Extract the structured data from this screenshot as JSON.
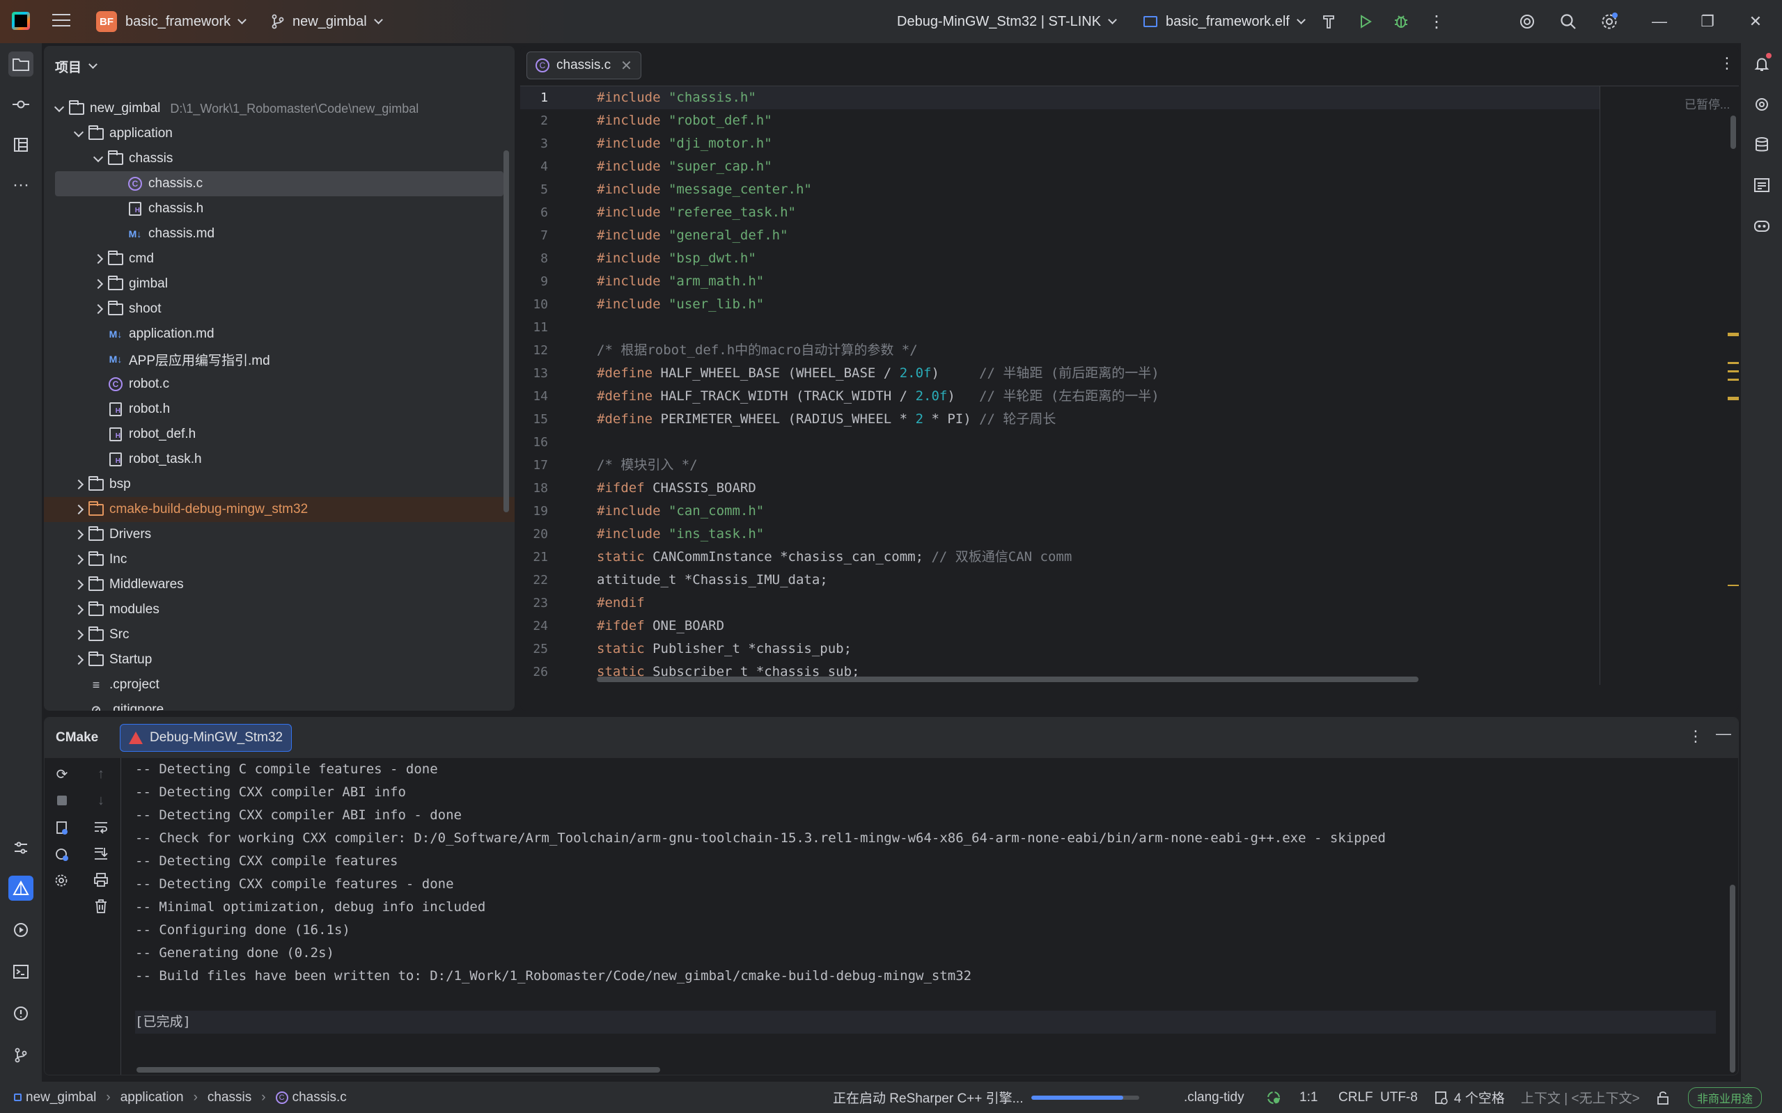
{
  "titlebar": {
    "project_badge": "BF",
    "project_name": "basic_framework",
    "branch": "new_gimbal",
    "run_config": "Debug-MinGW_Stm32 | ST-LINK",
    "target": "basic_framework.elf"
  },
  "project_panel": {
    "title": "项目",
    "tree": [
      {
        "label": "new_gimbal",
        "path": "D:\\1_Work\\1_Robomaster\\Code\\new_gimbal",
        "depth": 0,
        "type": "folder",
        "open": true
      },
      {
        "label": "application",
        "depth": 1,
        "type": "folder",
        "open": true
      },
      {
        "label": "chassis",
        "depth": 2,
        "type": "folder",
        "open": true
      },
      {
        "label": "chassis.c",
        "depth": 3,
        "type": "c",
        "selected": true
      },
      {
        "label": "chassis.h",
        "depth": 3,
        "type": "h"
      },
      {
        "label": "chassis.md",
        "depth": 3,
        "type": "md"
      },
      {
        "label": "cmd",
        "depth": 2,
        "type": "folder",
        "open": false
      },
      {
        "label": "gimbal",
        "depth": 2,
        "type": "folder",
        "open": false
      },
      {
        "label": "shoot",
        "depth": 2,
        "type": "folder",
        "open": false
      },
      {
        "label": "application.md",
        "depth": 2,
        "type": "md"
      },
      {
        "label": "APP层应用编写指引.md",
        "depth": 2,
        "type": "md"
      },
      {
        "label": "robot.c",
        "depth": 2,
        "type": "c"
      },
      {
        "label": "robot.h",
        "depth": 2,
        "type": "h"
      },
      {
        "label": "robot_def.h",
        "depth": 2,
        "type": "h"
      },
      {
        "label": "robot_task.h",
        "depth": 2,
        "type": "h"
      },
      {
        "label": "bsp",
        "depth": 1,
        "type": "folder",
        "open": false
      },
      {
        "label": "cmake-build-debug-mingw_stm32",
        "depth": 1,
        "type": "folder-excluded",
        "open": false
      },
      {
        "label": "Drivers",
        "depth": 1,
        "type": "folder",
        "open": false
      },
      {
        "label": "Inc",
        "depth": 1,
        "type": "folder",
        "open": false
      },
      {
        "label": "Middlewares",
        "depth": 1,
        "type": "folder",
        "open": false
      },
      {
        "label": "modules",
        "depth": 1,
        "type": "folder",
        "open": false
      },
      {
        "label": "Src",
        "depth": 1,
        "type": "folder",
        "open": false
      },
      {
        "label": "Startup",
        "depth": 1,
        "type": "folder",
        "open": false
      },
      {
        "label": ".cproject",
        "depth": 1,
        "type": "txt"
      },
      {
        "label": ".gitignore",
        "depth": 1,
        "type": "ignore"
      }
    ]
  },
  "editor": {
    "tab_label": "chassis.c",
    "inspection_status": "已暂停...",
    "current_line": 1,
    "lines": [
      [
        [
          "kw",
          "#include"
        ],
        [
          "",
          " "
        ],
        [
          "str",
          "\"chassis.h\""
        ]
      ],
      [
        [
          "kw",
          "#include"
        ],
        [
          "",
          " "
        ],
        [
          "str",
          "\"robot_def.h\""
        ]
      ],
      [
        [
          "kw",
          "#include"
        ],
        [
          "",
          " "
        ],
        [
          "str",
          "\"dji_motor.h\""
        ]
      ],
      [
        [
          "kw",
          "#include"
        ],
        [
          "",
          " "
        ],
        [
          "str",
          "\"super_cap.h\""
        ]
      ],
      [
        [
          "kw",
          "#include"
        ],
        [
          "",
          " "
        ],
        [
          "str",
          "\"message_center.h\""
        ]
      ],
      [
        [
          "kw",
          "#include"
        ],
        [
          "",
          " "
        ],
        [
          "str",
          "\"referee_task.h\""
        ]
      ],
      [
        [
          "kw",
          "#include"
        ],
        [
          "",
          " "
        ],
        [
          "str",
          "\"general_def.h\""
        ]
      ],
      [
        [
          "kw",
          "#include"
        ],
        [
          "",
          " "
        ],
        [
          "str",
          "\"bsp_dwt.h\""
        ]
      ],
      [
        [
          "kw",
          "#include"
        ],
        [
          "",
          " "
        ],
        [
          "str",
          "\"arm_math.h\""
        ]
      ],
      [
        [
          "kw",
          "#include"
        ],
        [
          "",
          " "
        ],
        [
          "str",
          "\"user_lib.h\""
        ]
      ],
      [],
      [
        [
          "cmt",
          "/* 根据robot_def.h中的macro自动计算的参数 */"
        ]
      ],
      [
        [
          "kw",
          "#define"
        ],
        [
          "",
          " HALF_WHEEL_BASE (WHEEL_BASE / "
        ],
        [
          "num",
          "2.0f"
        ],
        [
          "",
          ")     "
        ],
        [
          "cmt",
          "// 半轴距 (前后距离的一半)"
        ]
      ],
      [
        [
          "kw",
          "#define"
        ],
        [
          "",
          " HALF_TRACK_WIDTH (TRACK_WIDTH / "
        ],
        [
          "num",
          "2.0f"
        ],
        [
          "",
          ")   "
        ],
        [
          "cmt",
          "// 半轮距 (左右距离的一半)"
        ]
      ],
      [
        [
          "kw",
          "#define"
        ],
        [
          "",
          " PERIMETER_WHEEL (RADIUS_WHEEL * "
        ],
        [
          "num",
          "2"
        ],
        [
          "",
          " * PI) "
        ],
        [
          "cmt",
          "// 轮子周长"
        ]
      ],
      [],
      [
        [
          "cmt",
          "/* 模块引入 */"
        ]
      ],
      [
        [
          "kw",
          "#ifdef"
        ],
        [
          "",
          " CHASSIS_BOARD"
        ]
      ],
      [
        [
          "kw",
          "#include"
        ],
        [
          "",
          " "
        ],
        [
          "str",
          "\"can_comm.h\""
        ]
      ],
      [
        [
          "kw",
          "#include"
        ],
        [
          "",
          " "
        ],
        [
          "str",
          "\"ins_task.h\""
        ]
      ],
      [
        [
          "kw",
          "static"
        ],
        [
          "",
          " CANCommInstance *chasiss_can_comm; "
        ],
        [
          "cmt",
          "// 双板通信CAN comm"
        ]
      ],
      [
        [
          "",
          "attitude_t *Chassis_IMU_data;"
        ]
      ],
      [
        [
          "kw",
          "#endif"
        ]
      ],
      [
        [
          "kw",
          "#ifdef"
        ],
        [
          "",
          " ONE_BOARD"
        ]
      ],
      [
        [
          "kw",
          "static"
        ],
        [
          "",
          " Publisher_t *chassis_pub;"
        ]
      ],
      [
        [
          "kw",
          "static"
        ],
        [
          "",
          " Subscriber_t *chassis_sub;"
        ]
      ]
    ]
  },
  "bottom_panel": {
    "title": "CMake",
    "tab_label": "Debug-MinGW_Stm32",
    "console": [
      "-- Detecting C compile features - done",
      "-- Detecting CXX compiler ABI info",
      "-- Detecting CXX compiler ABI info - done",
      "-- Check for working CXX compiler: D:/0_Software/Arm_Toolchain/arm-gnu-toolchain-15.3.rel1-mingw-w64-x86_64-arm-none-eabi/bin/arm-none-eabi-g++.exe - skipped",
      "-- Detecting CXX compile features",
      "-- Detecting CXX compile features - done",
      "-- Minimal optimization, debug info included",
      "-- Configuring done (16.1s)",
      "-- Generating done (0.2s)",
      "-- Build files have been written to: D:/1_Work/1_Robomaster/Code/new_gimbal/cmake-build-debug-mingw_stm32",
      "",
      "[已完成]"
    ]
  },
  "statusbar": {
    "crumbs": [
      "new_gimbal",
      "application",
      "chassis",
      "chassis.c"
    ],
    "task_text": "正在启动 ReSharper C++ 引擎...",
    "task_progress": 0.85,
    "clang_tidy": ".clang-tidy",
    "position": "1:1",
    "line_sep": "CRLF",
    "encoding": "UTF-8",
    "indent": "4 个空格",
    "context": "上下文 | <无上下文>",
    "license": "非商业用途"
  },
  "colors": {
    "accent": "#3574f0",
    "keyword": "#cf8e6d",
    "string": "#6aab73",
    "number": "#2aacb8",
    "comment": "#7a7e85"
  }
}
